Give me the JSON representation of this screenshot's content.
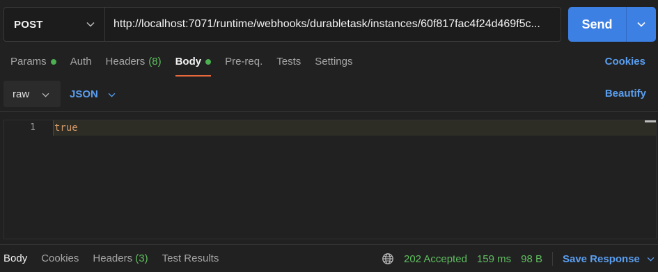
{
  "request": {
    "method": "POST",
    "url": "http://localhost:7071/runtime/webhooks/durabletask/instances/60f817fac4f24d469f5c...",
    "send_label": "Send"
  },
  "tabs": [
    {
      "label": "Params",
      "count": "",
      "dot": true,
      "active": false
    },
    {
      "label": "Auth",
      "count": "",
      "dot": false,
      "active": false
    },
    {
      "label": "Headers",
      "count": "(8)",
      "dot": false,
      "active": false
    },
    {
      "label": "Body",
      "count": "",
      "dot": true,
      "active": true
    },
    {
      "label": "Pre-req.",
      "count": "",
      "dot": false,
      "active": false
    },
    {
      "label": "Tests",
      "count": "",
      "dot": false,
      "active": false
    },
    {
      "label": "Settings",
      "count": "",
      "dot": false,
      "active": false
    }
  ],
  "cookies_link": "Cookies",
  "body_toolbar": {
    "body_type": "raw",
    "format": "JSON",
    "beautify_label": "Beautify"
  },
  "editor": {
    "line_number": "1",
    "line_text": "true"
  },
  "response": {
    "tabs": [
      {
        "label": "Body",
        "count": "",
        "active": true
      },
      {
        "label": "Cookies",
        "count": "",
        "active": false
      },
      {
        "label": "Headers",
        "count": "(3)",
        "active": false
      },
      {
        "label": "Test Results",
        "count": "",
        "active": false
      }
    ],
    "status": "202 Accepted",
    "time": "159 ms",
    "size": "98 B",
    "save_label": "Save Response"
  },
  "colors": {
    "accent_blue": "#3d80e3",
    "link_blue": "#5a9ef0",
    "success_green": "#5fbf5f",
    "active_tab_underline": "#e8673d"
  },
  "icons": [
    "chevron-down-icon",
    "globe-icon"
  ]
}
